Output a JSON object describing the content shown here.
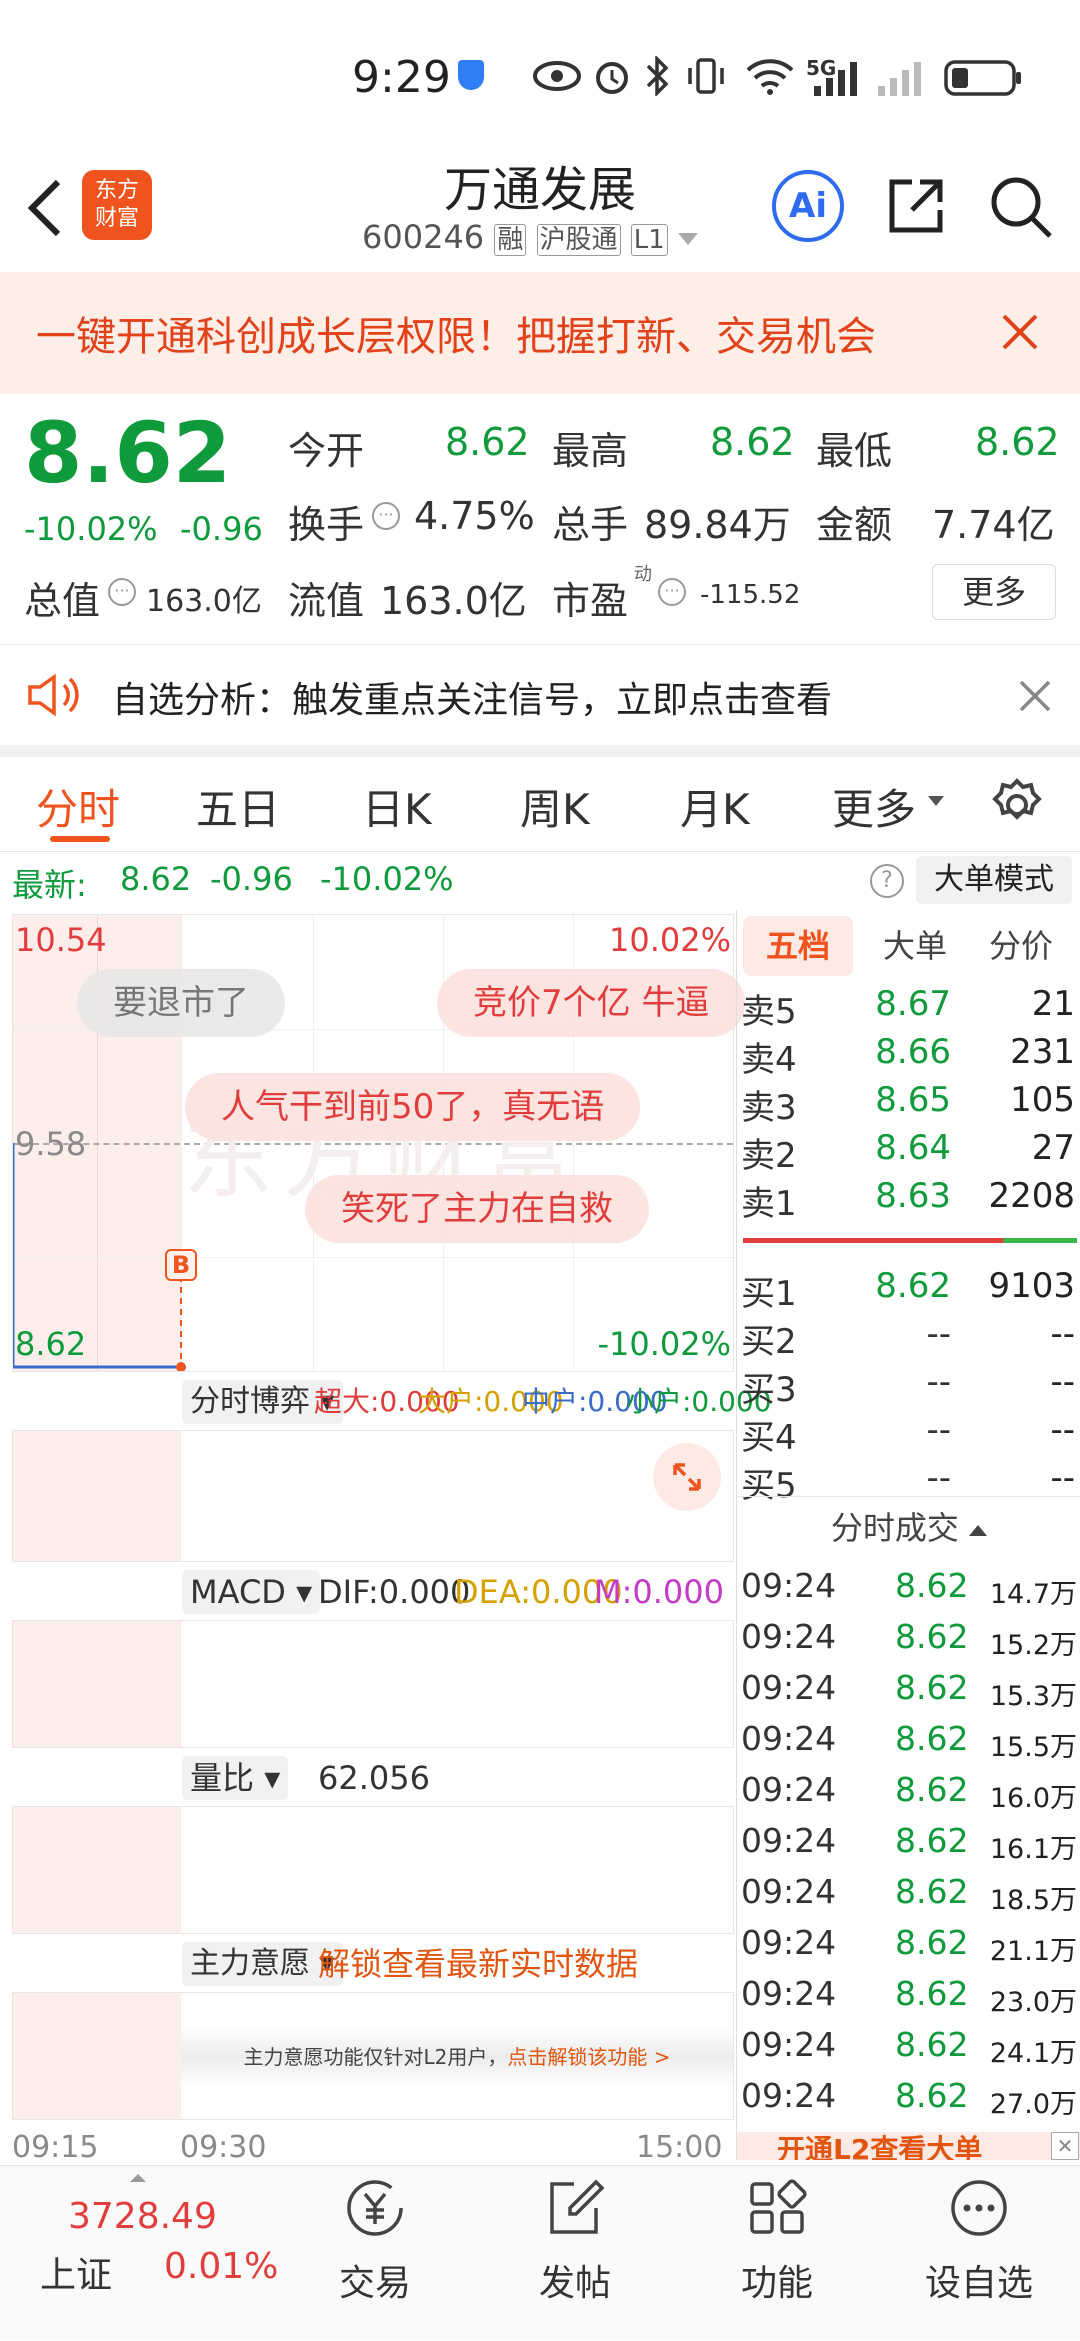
{
  "status_bar": {
    "time": "9:29",
    "network": "5G"
  },
  "nav": {
    "logo_text": "东方\n财富",
    "stock_name": "万通发展",
    "stock_code": "600246",
    "tags": [
      "融",
      "沪股通",
      "L1"
    ],
    "ai_label": "Ai"
  },
  "banner": {
    "text": "一键开通科创成长层权限！把握打新、交易机会"
  },
  "quote": {
    "price": "8.62",
    "change_pct": "-10.02%",
    "change": "-0.96",
    "open_label": "今开",
    "open": "8.62",
    "high_label": "最高",
    "high": "8.62",
    "low_label": "最低",
    "low": "8.62",
    "turnover_label": "换手",
    "turnover": "4.75%",
    "volume_label": "总手",
    "volume": "89.84万",
    "amount_label": "金额",
    "amount": "7.74亿",
    "mktcap_label": "总值",
    "mktcap": "163.0亿",
    "float_label": "流值",
    "float": "163.0亿",
    "pe_label": "市盈",
    "pe_sup": "动",
    "pe": "-115.52",
    "more_button": "更多"
  },
  "notice": {
    "text": "自选分析：触发重点关注信号，立即点击查看"
  },
  "tabs": [
    "分时",
    "五日",
    "日K",
    "周K",
    "月K",
    "更多"
  ],
  "latest": {
    "label": "最新:",
    "price": "8.62",
    "change": "-0.96",
    "pct": "-10.02%",
    "help": "?",
    "mode_button": "大单模式"
  },
  "chart": {
    "y_top": "10.54",
    "y_top_pct": "10.02%",
    "y_mid": "9.58",
    "y_bottom": "8.62",
    "y_bottom_pct": "-10.02%",
    "marker": "B",
    "danmu": [
      "要退市了",
      "竞价7个亿 牛逼",
      "人气干到前50了，真无语",
      "笑死了主力在自救"
    ],
    "watermark": "东方财富",
    "ind1": {
      "name": "分时博弈",
      "v1": "超大:0.000",
      "v2": "大户:0.000",
      "v3": "中户:0.000",
      "v4": "小户:0.000"
    },
    "ind2": {
      "name": "MACD",
      "v1": "DIF:0.000",
      "v2": "DEA:0.000",
      "v3": "M:0.000"
    },
    "ind3": {
      "name": "量比",
      "v1": "62.056"
    },
    "ind4": {
      "name": "主力意愿",
      "v1": "解锁查看最新实时数据",
      "note": "主力意愿功能仅针对L2用户，",
      "note_link": "点击解锁该功能 >"
    },
    "x_labels": [
      "09:15",
      "09:30",
      "15:00"
    ]
  },
  "book": {
    "tabs": [
      "五档",
      "大单",
      "分价"
    ],
    "asks": [
      {
        "label": "卖5",
        "price": "8.67",
        "vol": "21"
      },
      {
        "label": "卖4",
        "price": "8.66",
        "vol": "231"
      },
      {
        "label": "卖3",
        "price": "8.65",
        "vol": "105"
      },
      {
        "label": "卖2",
        "price": "8.64",
        "vol": "27"
      },
      {
        "label": "卖1",
        "price": "8.63",
        "vol": "2208"
      }
    ],
    "bids": [
      {
        "label": "买1",
        "price": "8.62",
        "vol": "9103"
      },
      {
        "label": "买2",
        "price": "--",
        "vol": "--"
      },
      {
        "label": "买3",
        "price": "--",
        "vol": "--"
      },
      {
        "label": "买4",
        "price": "--",
        "vol": "--"
      },
      {
        "label": "买5",
        "price": "--",
        "vol": "--"
      }
    ],
    "trades_title": "分时成交",
    "trades": [
      {
        "time": "09:24",
        "price": "8.62",
        "vol": "14.7万"
      },
      {
        "time": "09:24",
        "price": "8.62",
        "vol": "15.2万"
      },
      {
        "time": "09:24",
        "price": "8.62",
        "vol": "15.3万"
      },
      {
        "time": "09:24",
        "price": "8.62",
        "vol": "15.5万"
      },
      {
        "time": "09:24",
        "price": "8.62",
        "vol": "16.0万"
      },
      {
        "time": "09:24",
        "price": "8.62",
        "vol": "16.1万"
      },
      {
        "time": "09:24",
        "price": "8.62",
        "vol": "18.5万"
      },
      {
        "time": "09:24",
        "price": "8.62",
        "vol": "21.1万"
      },
      {
        "time": "09:24",
        "price": "8.62",
        "vol": "23.0万"
      },
      {
        "time": "09:24",
        "price": "8.62",
        "vol": "24.1万"
      },
      {
        "time": "09:24",
        "price": "8.62",
        "vol": "27.0万"
      }
    ],
    "l2_banner": "开通L2查看大单"
  },
  "bottom": {
    "index_value": "3728.49",
    "index_name": "上证",
    "index_pct": "0.01%",
    "trade": "交易",
    "post": "发帖",
    "func": "功能",
    "watch": "设自选"
  }
}
